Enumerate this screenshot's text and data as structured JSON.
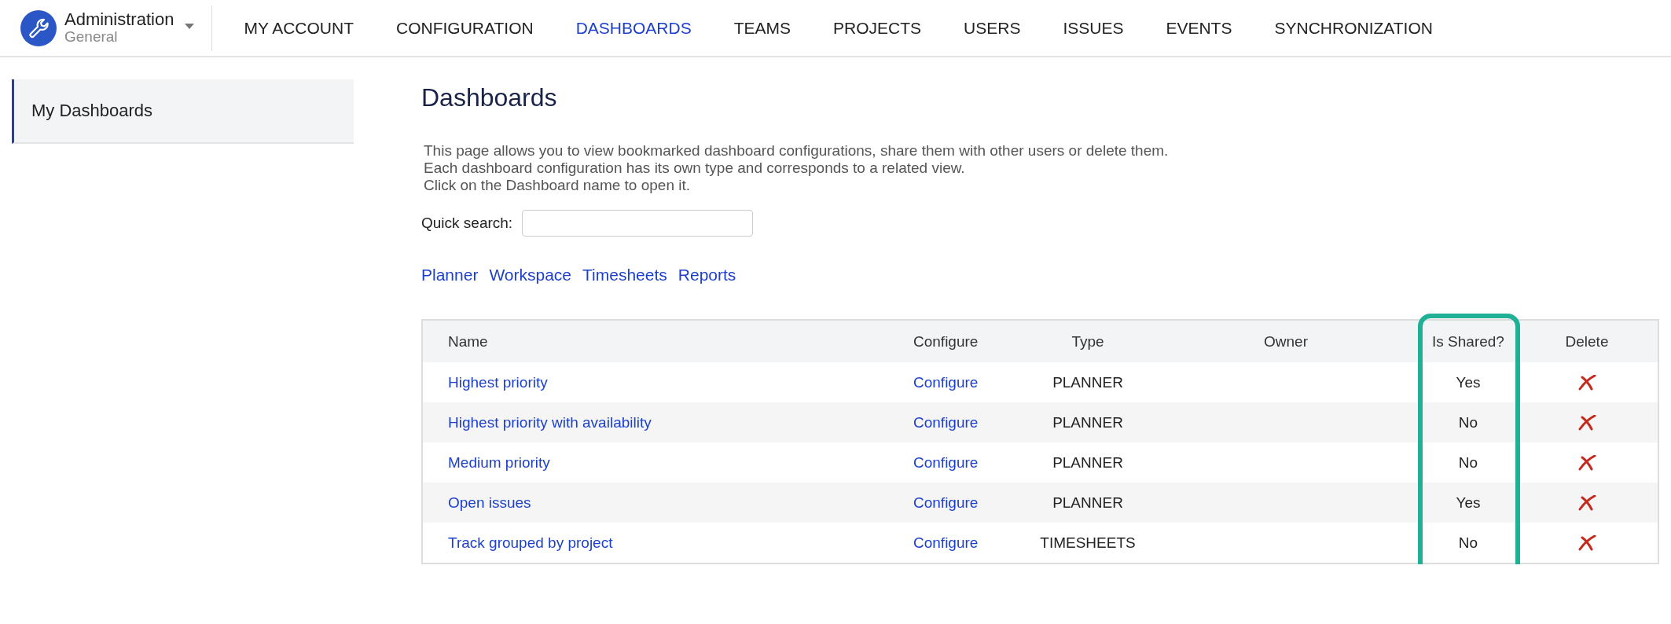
{
  "app": {
    "title": "Administration",
    "subtitle": "General"
  },
  "nav": [
    {
      "label": "MY ACCOUNT",
      "selected": false
    },
    {
      "label": "CONFIGURATION",
      "selected": false
    },
    {
      "label": "DASHBOARDS",
      "selected": true
    },
    {
      "label": "TEAMS",
      "selected": false
    },
    {
      "label": "PROJECTS",
      "selected": false
    },
    {
      "label": "USERS",
      "selected": false
    },
    {
      "label": "ISSUES",
      "selected": false
    },
    {
      "label": "EVENTS",
      "selected": false
    },
    {
      "label": "SYNCHRONIZATION",
      "selected": false
    }
  ],
  "sidebar": {
    "items": [
      {
        "label": "My Dashboards",
        "selected": true
      }
    ]
  },
  "page": {
    "title": "Dashboards",
    "description": [
      "This page allows you to view bookmarked dashboard configurations, share them with other users or delete them.",
      "Each dashboard configuration has its own type and corresponds to a related view.",
      "Click on the Dashboard name to open it."
    ],
    "search": {
      "label": "Quick search:"
    },
    "filters": [
      "Planner",
      "Workspace",
      "Timesheets",
      "Reports"
    ]
  },
  "table": {
    "columns": [
      {
        "label": "Name",
        "highlighted": false
      },
      {
        "label": "Configure",
        "highlighted": false
      },
      {
        "label": "Type",
        "highlighted": false
      },
      {
        "label": "Owner",
        "highlighted": false
      },
      {
        "label": "Is Shared?",
        "highlighted": true
      },
      {
        "label": "Delete",
        "highlighted": false
      }
    ],
    "rows": [
      {
        "name": "Highest priority",
        "configure": "Configure",
        "type": "PLANNER",
        "shared": "Yes"
      },
      {
        "name": "Highest priority with availability",
        "configure": "Configure",
        "type": "PLANNER",
        "shared": "No"
      },
      {
        "name": "Medium priority",
        "configure": "Configure",
        "type": "PLANNER",
        "shared": "No"
      },
      {
        "name": "Open issues",
        "configure": "Configure",
        "type": "PLANNER",
        "shared": "Yes"
      },
      {
        "name": "Track grouped by project",
        "configure": "Configure",
        "type": "TIMESHEETS",
        "shared": "No"
      }
    ]
  }
}
